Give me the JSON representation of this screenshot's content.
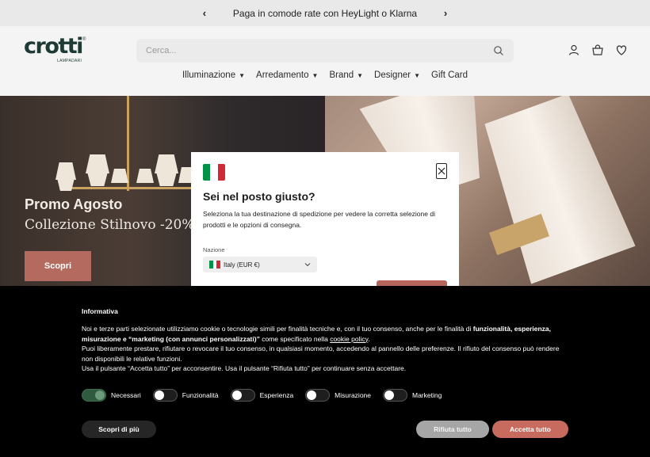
{
  "announcement": {
    "prev_icon": "chevron-left-icon",
    "text": "Paga in comode rate con HeyLight o Klarna",
    "next_icon": "chevron-right-icon"
  },
  "header": {
    "logo_word": "crotti",
    "logo_sub": "LAMPADARI",
    "logo_reg": "®",
    "search_placeholder": "Cerca...",
    "icons": [
      "search-icon",
      "account-icon",
      "cart-icon",
      "wishlist-icon"
    ]
  },
  "nav": {
    "items": [
      {
        "label": "Illuminazione",
        "has_dropdown": true
      },
      {
        "label": "Arredamento",
        "has_dropdown": true
      },
      {
        "label": "Brand",
        "has_dropdown": true
      },
      {
        "label": "Designer",
        "has_dropdown": true
      },
      {
        "label": "Gift Card",
        "has_dropdown": false
      }
    ]
  },
  "hero": {
    "title": "Promo Agosto",
    "subtitle": "Collezione Stilnovo -20%",
    "cta": "Scopri"
  },
  "modal": {
    "title": "Sei nel posto giusto?",
    "text": "Seleziona la tua destinazione di spedizione per vedere la corretta selezione di prodotti e le opzioni di consegna.",
    "nation_label": "Nazione",
    "nation_value": "Italy (EUR €)",
    "flag_colors": [
      "#009246",
      "#ffffff",
      "#ce2b37"
    ],
    "confirm_color": "#b5655a"
  },
  "cookie": {
    "title": "Informativa",
    "p1_a": "Noi e terze parti selezionate utilizziamo cookie o tecnologie simili per finalità tecniche e, con il tuo consenso, anche per le finalità di ",
    "p1_bold": "funzionalità, esperienza, misurazione e “marketing (con annunci personalizzati)”",
    "p1_b": " come specificato nella ",
    "p1_link": "cookie policy",
    "p1_c": ".",
    "p2": "Puoi liberamente prestare, rifiutare o revocare il tuo consenso, in qualsiasi momento, accedendo al pannello delle preferenze. Il rifiuto del consenso può rendere non disponibili le relative funzioni.",
    "p3": "Usa il pulsante “Accetta tutto” per acconsentire. Usa il pulsante “Rifiuta tutto” per continuare senza accettare.",
    "toggles": [
      {
        "label": "Necessari",
        "on": true
      },
      {
        "label": "Funzionalità",
        "on": false
      },
      {
        "label": "Esperienza",
        "on": false
      },
      {
        "label": "Misurazione",
        "on": false
      },
      {
        "label": "Marketing",
        "on": false
      }
    ],
    "more_button": "Scopri di più",
    "reject_button": "Rifiuta tutto",
    "accept_button": "Accetta tutto",
    "accept_color": "#c66b5e"
  }
}
